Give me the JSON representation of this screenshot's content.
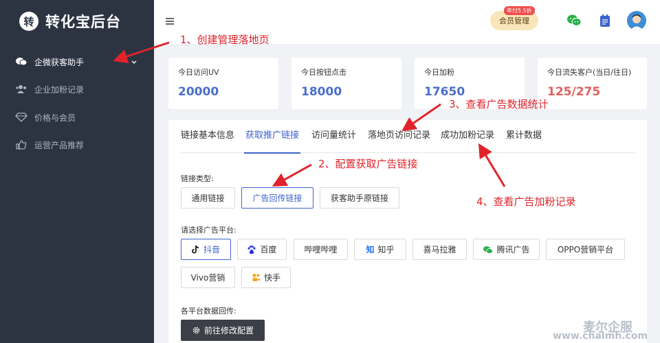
{
  "sidebar": {
    "logo_char": "转",
    "title": "转化宝后台",
    "items": [
      {
        "label": "企微获客助手",
        "icon": "chat-bubbles-icon"
      },
      {
        "label": "企业加粉记录",
        "icon": "add-users-icon"
      },
      {
        "label": "价格与会员",
        "icon": "diamond-icon"
      },
      {
        "label": "运营产品推荐",
        "icon": "thumbs-up-icon"
      }
    ]
  },
  "header": {
    "vip_badge": "年付5.5折",
    "vip_label": "会员管理"
  },
  "stats": [
    {
      "label": "今日访问UV",
      "value": "20000"
    },
    {
      "label": "今日按钮点击",
      "value": "18000"
    },
    {
      "label": "今日加粉",
      "value": "17650"
    },
    {
      "label": "今日流失客户(当日/往日)",
      "value": "125/275"
    }
  ],
  "tabs": [
    "链接基本信息",
    "获取推广链接",
    "访问量统计",
    "落地页访问记录",
    "成功加粉记录",
    "累计数据"
  ],
  "link_type": {
    "label": "链接类型:",
    "options": [
      "通用链接",
      "广告回传链接",
      "获客助手原链接"
    ],
    "selected": "广告回传链接"
  },
  "platform": {
    "label": "请选择广告平台:",
    "options": [
      "抖音",
      "百度",
      "哔哩哔哩",
      "知乎",
      "喜马拉雅",
      "腾讯广告",
      "OPPO营销平台",
      "Vivo营销",
      "快手"
    ],
    "selected": "抖音"
  },
  "callback": {
    "label": "各平台数据回传:",
    "button": "前往修改配置"
  },
  "annotations": [
    "1、创建管理落地页",
    "2、配置获取广告链接",
    "3、查看广告数据统计",
    "4、查看广告加粉记录"
  ],
  "watermark": {
    "brand": "麦尔企服",
    "url": "www.chalmh.com"
  },
  "colors": {
    "sidebar": "#2c3442",
    "accent": "#3b63c9",
    "stat_value": "#4a6fc9",
    "stat_value_alert": "#e0605f",
    "annotation": "#e0232b",
    "vip": "#f8e6b8"
  }
}
